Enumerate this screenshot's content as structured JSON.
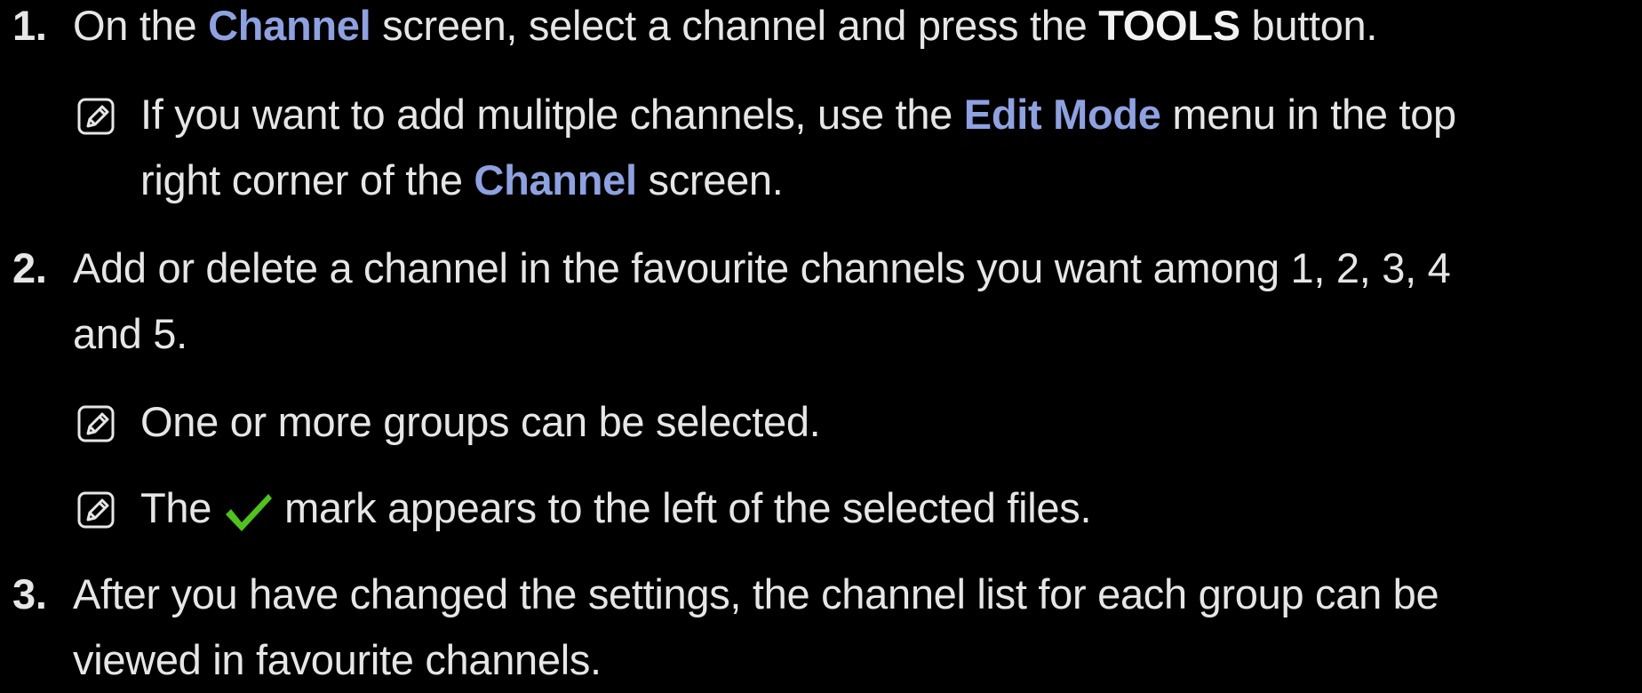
{
  "steps": [
    {
      "number": "1.",
      "pre": "On the ",
      "link1": "Channel",
      "mid": " screen, select a channel and press the ",
      "button": "TOOLS",
      "post": " button."
    },
    {
      "number": "2.",
      "line1": "Add or delete a channel in the favourite channels you want among 1, 2, 3, 4",
      "line2": "and 5."
    },
    {
      "number": "3.",
      "line1": "After you have changed the settings, the channel list for each group can be",
      "line2": "viewed in favourite channels."
    }
  ],
  "notes": [
    {
      "icon": "note-icon",
      "pre": "If you want to add mulitple channels, use the ",
      "link1": "Edit Mode",
      "mid": " menu in the top",
      "line2_pre": "right corner of the ",
      "link2": "Channel",
      "post": " screen."
    },
    {
      "icon": "note-icon",
      "text": "One or more groups can be selected."
    },
    {
      "icon": "note-icon",
      "pre": "The",
      "check_icon": "checkmark-icon",
      "post": "mark appears to the left of the selected files."
    }
  ],
  "colors": {
    "background": "#000000",
    "text": "#e6e6e6",
    "highlight": "#8ea1e0",
    "check": "#4fc21e"
  }
}
